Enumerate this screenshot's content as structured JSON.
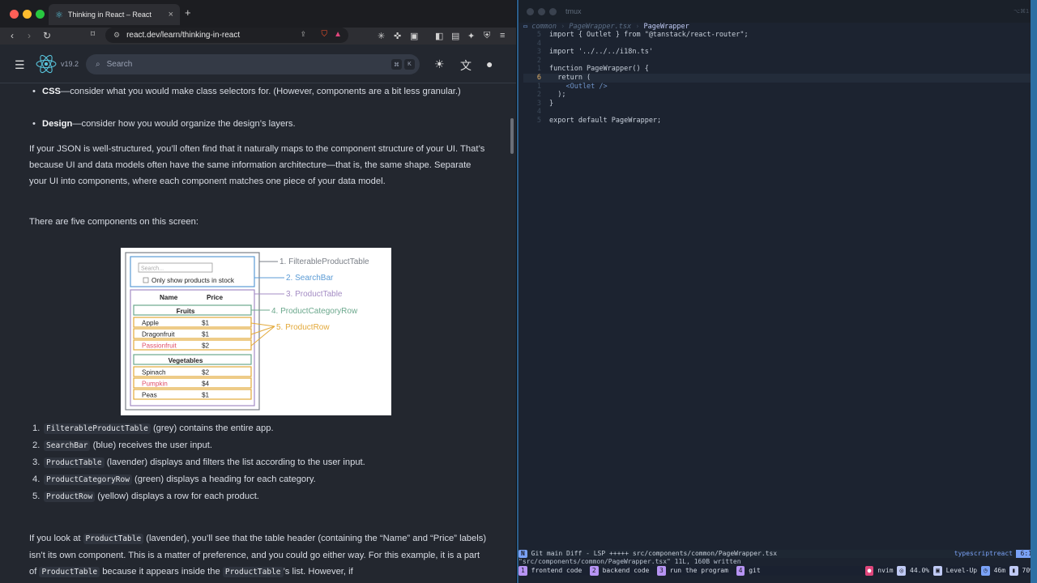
{
  "browser": {
    "tab_title": "Thinking in React – React",
    "new_tab": "+",
    "url": "react.dev/learn/thinking-in-react",
    "version": "v19.2",
    "search_placeholder": "Search",
    "kbd_cmd": "⌘",
    "kbd_k": "K"
  },
  "article": {
    "bullet_css_bold": "CSS",
    "bullet_css_text": "—consider what you would make class selectors for. (However, components are a bit less granular.)",
    "bullet_design_bold": "Design",
    "bullet_design_text": "—consider how you would organize the design’s layers.",
    "para_json": "If your JSON is well-structured, you’ll often find that it naturally maps to the component structure of your UI. That’s because UI and data models often have the same information architecture—that is, the same shape. Separate your UI into components, where each component matches one piece of your data model.",
    "para_five": "There are five components on this screen:",
    "list": [
      {
        "num": "1.",
        "code": "FilterableProductTable",
        "text": " (grey) contains the entire app."
      },
      {
        "num": "2.",
        "code": "SearchBar",
        "text": " (blue) receives the user input."
      },
      {
        "num": "3.",
        "code": "ProductTable",
        "text": " (lavender) displays and filters the list according to the user input."
      },
      {
        "num": "4.",
        "code": "ProductCategoryRow",
        "text": " (green) displays a heading for each category."
      },
      {
        "num": "5.",
        "code": "ProductRow",
        "text": " (yellow) displays a row for each product."
      }
    ],
    "para_last_1": "If you look at ",
    "para_last_code1": "ProductTable",
    "para_last_2": " (lavender), you’ll see that the table header (containing the “Name” and “Price” labels) isn’t its own component. This is a matter of preference, and you could go either way. For this example, it is a part of ",
    "para_last_code2": "ProductTable",
    "para_last_3": " because it appears inside the ",
    "para_last_code3": "ProductTable",
    "para_last_4": "’s list. However, if"
  },
  "diagram": {
    "search_placeholder": "Search...",
    "checkbox_label": "Only show products in stock",
    "col_name": "Name",
    "col_price": "Price",
    "cat1": "Fruits",
    "cat2": "Vegetables",
    "rows1": [
      [
        "Apple",
        "$1"
      ],
      [
        "Dragonfruit",
        "$1"
      ],
      [
        "Passionfruit",
        "$2"
      ]
    ],
    "rows2": [
      [
        "Spinach",
        "$2"
      ],
      [
        "Pumpkin",
        "$4"
      ],
      [
        "Peas",
        "$1"
      ]
    ],
    "labels": [
      "1. FilterableProductTable",
      "2. SearchBar",
      "3. ProductTable",
      "4. ProductCategoryRow",
      "5. ProductRow"
    ],
    "colors": {
      "grey": "#7a7f87",
      "blue": "#5b9bd5",
      "lavender": "#a48cc4",
      "green": "#6ca88d",
      "yellow": "#e3a93a",
      "red": "#e0506a"
    }
  },
  "terminal": {
    "title": "tmux",
    "title_right": "⌥⌘1",
    "crumb_dir": "common",
    "crumb_file": "PageWrapper.tsx",
    "crumb_sym": "PageWrapper",
    "lines": [
      {
        "n": "5",
        "t": "import { Outlet } from \"@tanstack/react-router\";"
      },
      {
        "n": "4",
        "t": ""
      },
      {
        "n": "3",
        "t": "import '../../../i18n.ts'"
      },
      {
        "n": "2",
        "t": ""
      },
      {
        "n": "1",
        "t": "function PageWrapper() {"
      },
      {
        "n": "6",
        "t": "  return ("
      },
      {
        "n": "1",
        "t": "    <Outlet />"
      },
      {
        "n": "2",
        "t": "  );"
      },
      {
        "n": "3",
        "t": "}"
      },
      {
        "n": "4",
        "t": ""
      },
      {
        "n": "5",
        "t": "export default PageWrapper;"
      }
    ],
    "status_mode": "N",
    "status_git": "Git main Diff - LSP +++++",
    "status_file": "src/components/common/PageWrapper.tsx",
    "status_ft": "typescriptreact",
    "status_pos": "6:1",
    "message": "\"src/components/common/PageWrapper.tsx\" 11L, 160B written",
    "tmux_windows": [
      {
        "n": "1",
        "name": "frontend code"
      },
      {
        "n": "2",
        "name": "backend code"
      },
      {
        "n": "3",
        "name": "run the program"
      },
      {
        "n": "4",
        "name": "git"
      }
    ],
    "tmux_right": {
      "app": "nvim",
      "cpu": "44.0%",
      "level": "Level-Up",
      "time": "46m",
      "battery": "70%"
    }
  }
}
